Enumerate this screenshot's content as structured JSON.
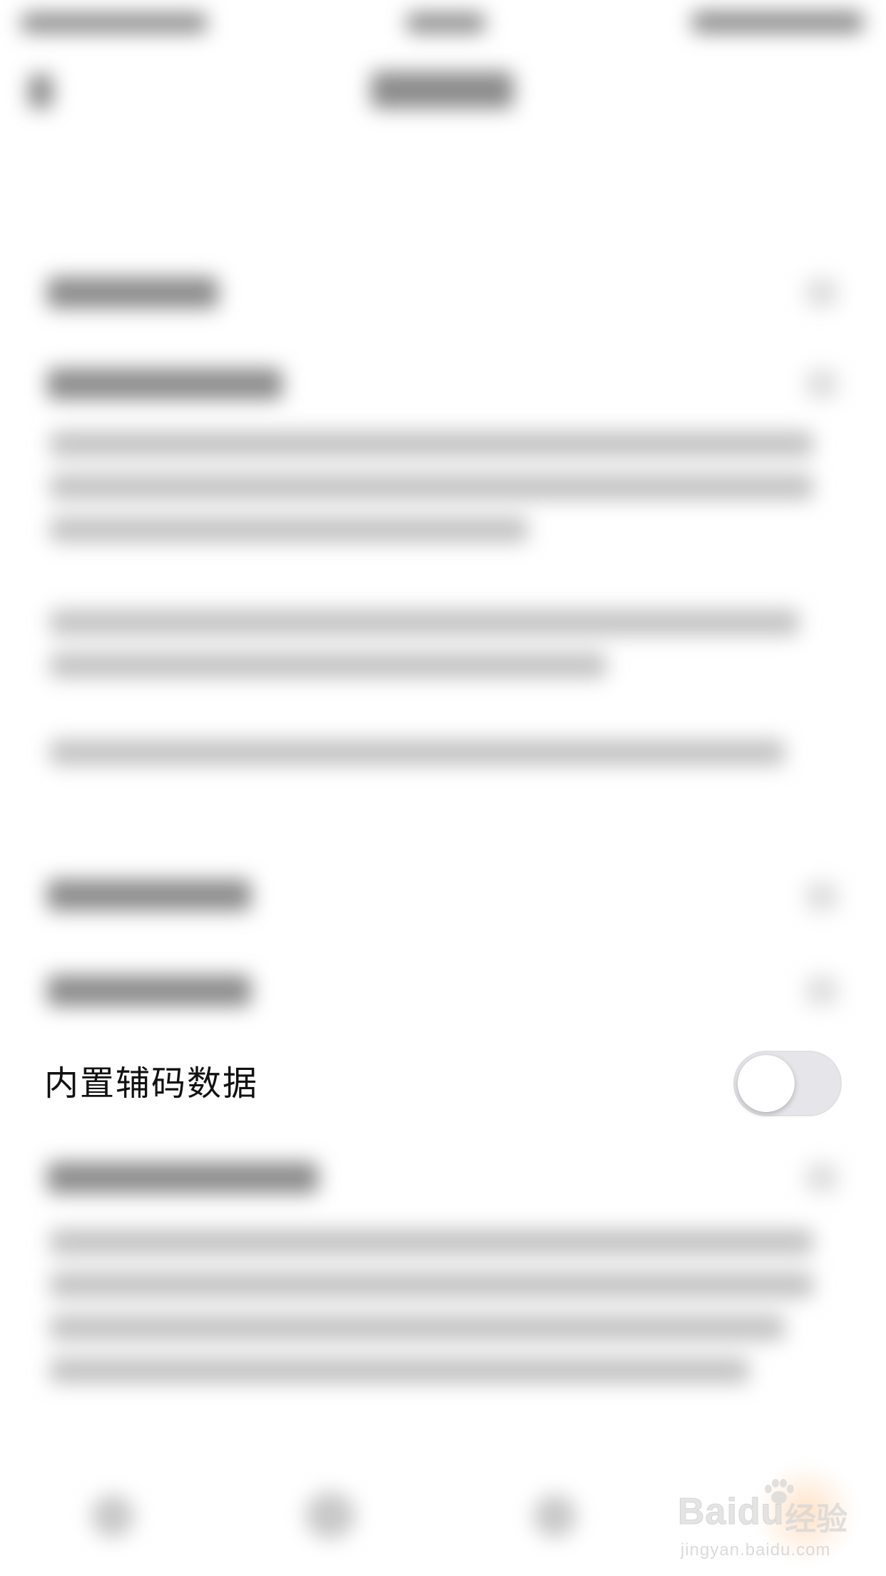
{
  "settings": {
    "builtin_code_data": {
      "label": "内置辅码数据",
      "enabled": false
    }
  },
  "watermark": {
    "brand": "Bai",
    "brand_du": "du",
    "brand_cn": "经验",
    "url": "jingyan.baidu.com"
  },
  "colors": {
    "toggle_off_track": "#e6e6ea",
    "toggle_knob": "#ffffff",
    "label_text": "#111111",
    "watermark_glow": "#ffbe82"
  }
}
